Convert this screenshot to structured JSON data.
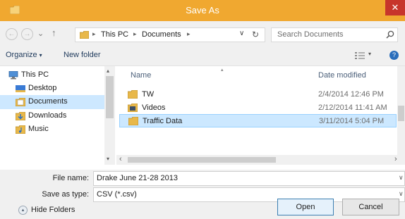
{
  "window": {
    "title": "Save As",
    "close_glyph": "✕"
  },
  "nav": {
    "back_glyph": "←",
    "forward_glyph": "→",
    "recent_glyph": "⌄",
    "up_glyph": "↑",
    "breadcrumbs": [
      "This PC",
      "Documents"
    ],
    "crumb_sep": "▸",
    "dropdown_glyph": "∨",
    "refresh_glyph": "↻",
    "search_placeholder": "Search Documents"
  },
  "toolbar": {
    "organize_label": "Organize",
    "caret": "▾",
    "new_folder_label": "New folder",
    "help_glyph": "?"
  },
  "sidebar": {
    "items": [
      {
        "label": "This PC",
        "icon": "computer-icon"
      },
      {
        "label": "Desktop",
        "icon": "desktop-icon"
      },
      {
        "label": "Documents",
        "icon": "documents-icon",
        "selected": true
      },
      {
        "label": "Downloads",
        "icon": "downloads-icon"
      },
      {
        "label": "Music",
        "icon": "music-icon"
      }
    ],
    "scroll_up": "▴",
    "scroll_down": "▾"
  },
  "files": {
    "columns": {
      "name": "Name",
      "date": "Date modified"
    },
    "sort_glyph": "▴",
    "rows": [
      {
        "name": "TW",
        "date": "2/4/2014 12:46 PM",
        "icon": "folder-icon"
      },
      {
        "name": "Videos",
        "date": "2/12/2014 11:41 AM",
        "icon": "videos-folder-icon"
      },
      {
        "name": "Traffic Data",
        "date": "3/11/2014 5:04 PM",
        "icon": "folder-icon",
        "selected": true
      }
    ],
    "hscroll_left": "‹",
    "hscroll_right": "›"
  },
  "form": {
    "file_name_label": "File name:",
    "file_name_value": "Drake June 21-28 2013",
    "save_type_label": "Save as type:",
    "save_type_value": "CSV (*.csv)",
    "dropdown_glyph": "∨"
  },
  "footer": {
    "hide_glyph": "▴",
    "hide_folders_label": "Hide Folders",
    "open_label": "Open",
    "cancel_label": "Cancel"
  },
  "colors": {
    "title_bar": "#f0a830",
    "close_button": "#c7352b",
    "selection": "#cce8ff",
    "folder": "#e8b84a"
  }
}
